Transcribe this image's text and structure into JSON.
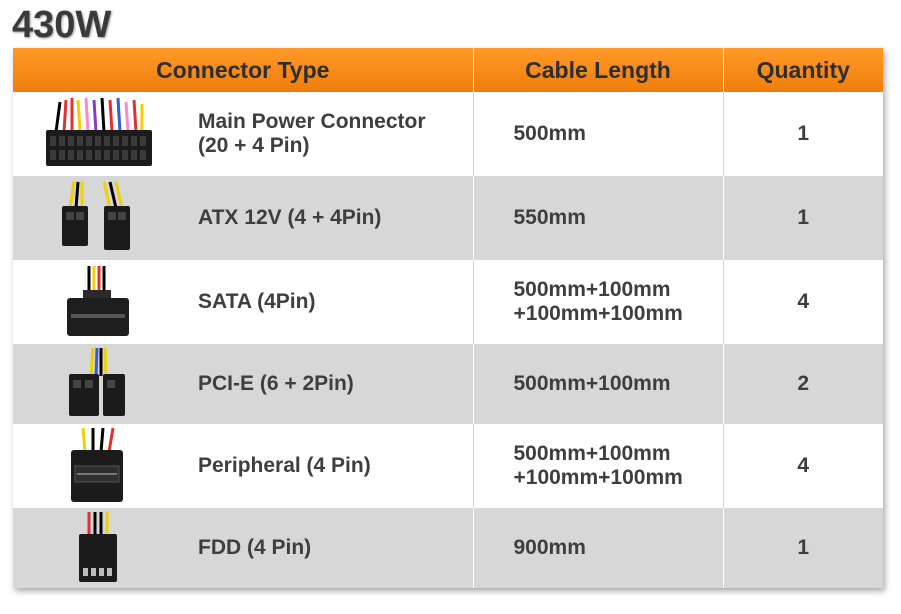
{
  "title": "430W",
  "headers": {
    "connector": "Connector Type",
    "length": "Cable Length",
    "quantity": "Quantity"
  },
  "rows": [
    {
      "name_lines": [
        "Main Power Connector",
        "(20 + 4 Pin)"
      ],
      "length_lines": [
        "500mm"
      ],
      "quantity": "1",
      "icon": "atx-24pin-connector-icon"
    },
    {
      "name_lines": [
        "ATX 12V (4 + 4Pin)"
      ],
      "length_lines": [
        "550mm"
      ],
      "quantity": "1",
      "icon": "atx-12v-connector-icon"
    },
    {
      "name_lines": [
        "SATA (4Pin)"
      ],
      "length_lines": [
        "500mm+100mm",
        "+100mm+100mm"
      ],
      "quantity": "4",
      "icon": "sata-connector-icon"
    },
    {
      "name_lines": [
        "PCI-E (6 + 2Pin)"
      ],
      "length_lines": [
        "500mm+100mm"
      ],
      "quantity": "2",
      "icon": "pcie-connector-icon"
    },
    {
      "name_lines": [
        "Peripheral (4 Pin)"
      ],
      "length_lines": [
        "500mm+100mm",
        "+100mm+100mm"
      ],
      "quantity": "4",
      "icon": "molex-connector-icon"
    },
    {
      "name_lines": [
        "FDD (4 Pin)"
      ],
      "length_lines": [
        "900mm"
      ],
      "quantity": "1",
      "icon": "fdd-connector-icon"
    }
  ],
  "colors": {
    "header_orange": "#f58a1a",
    "row_gray": "#d7d7d7",
    "text": "#3e3e3e"
  }
}
